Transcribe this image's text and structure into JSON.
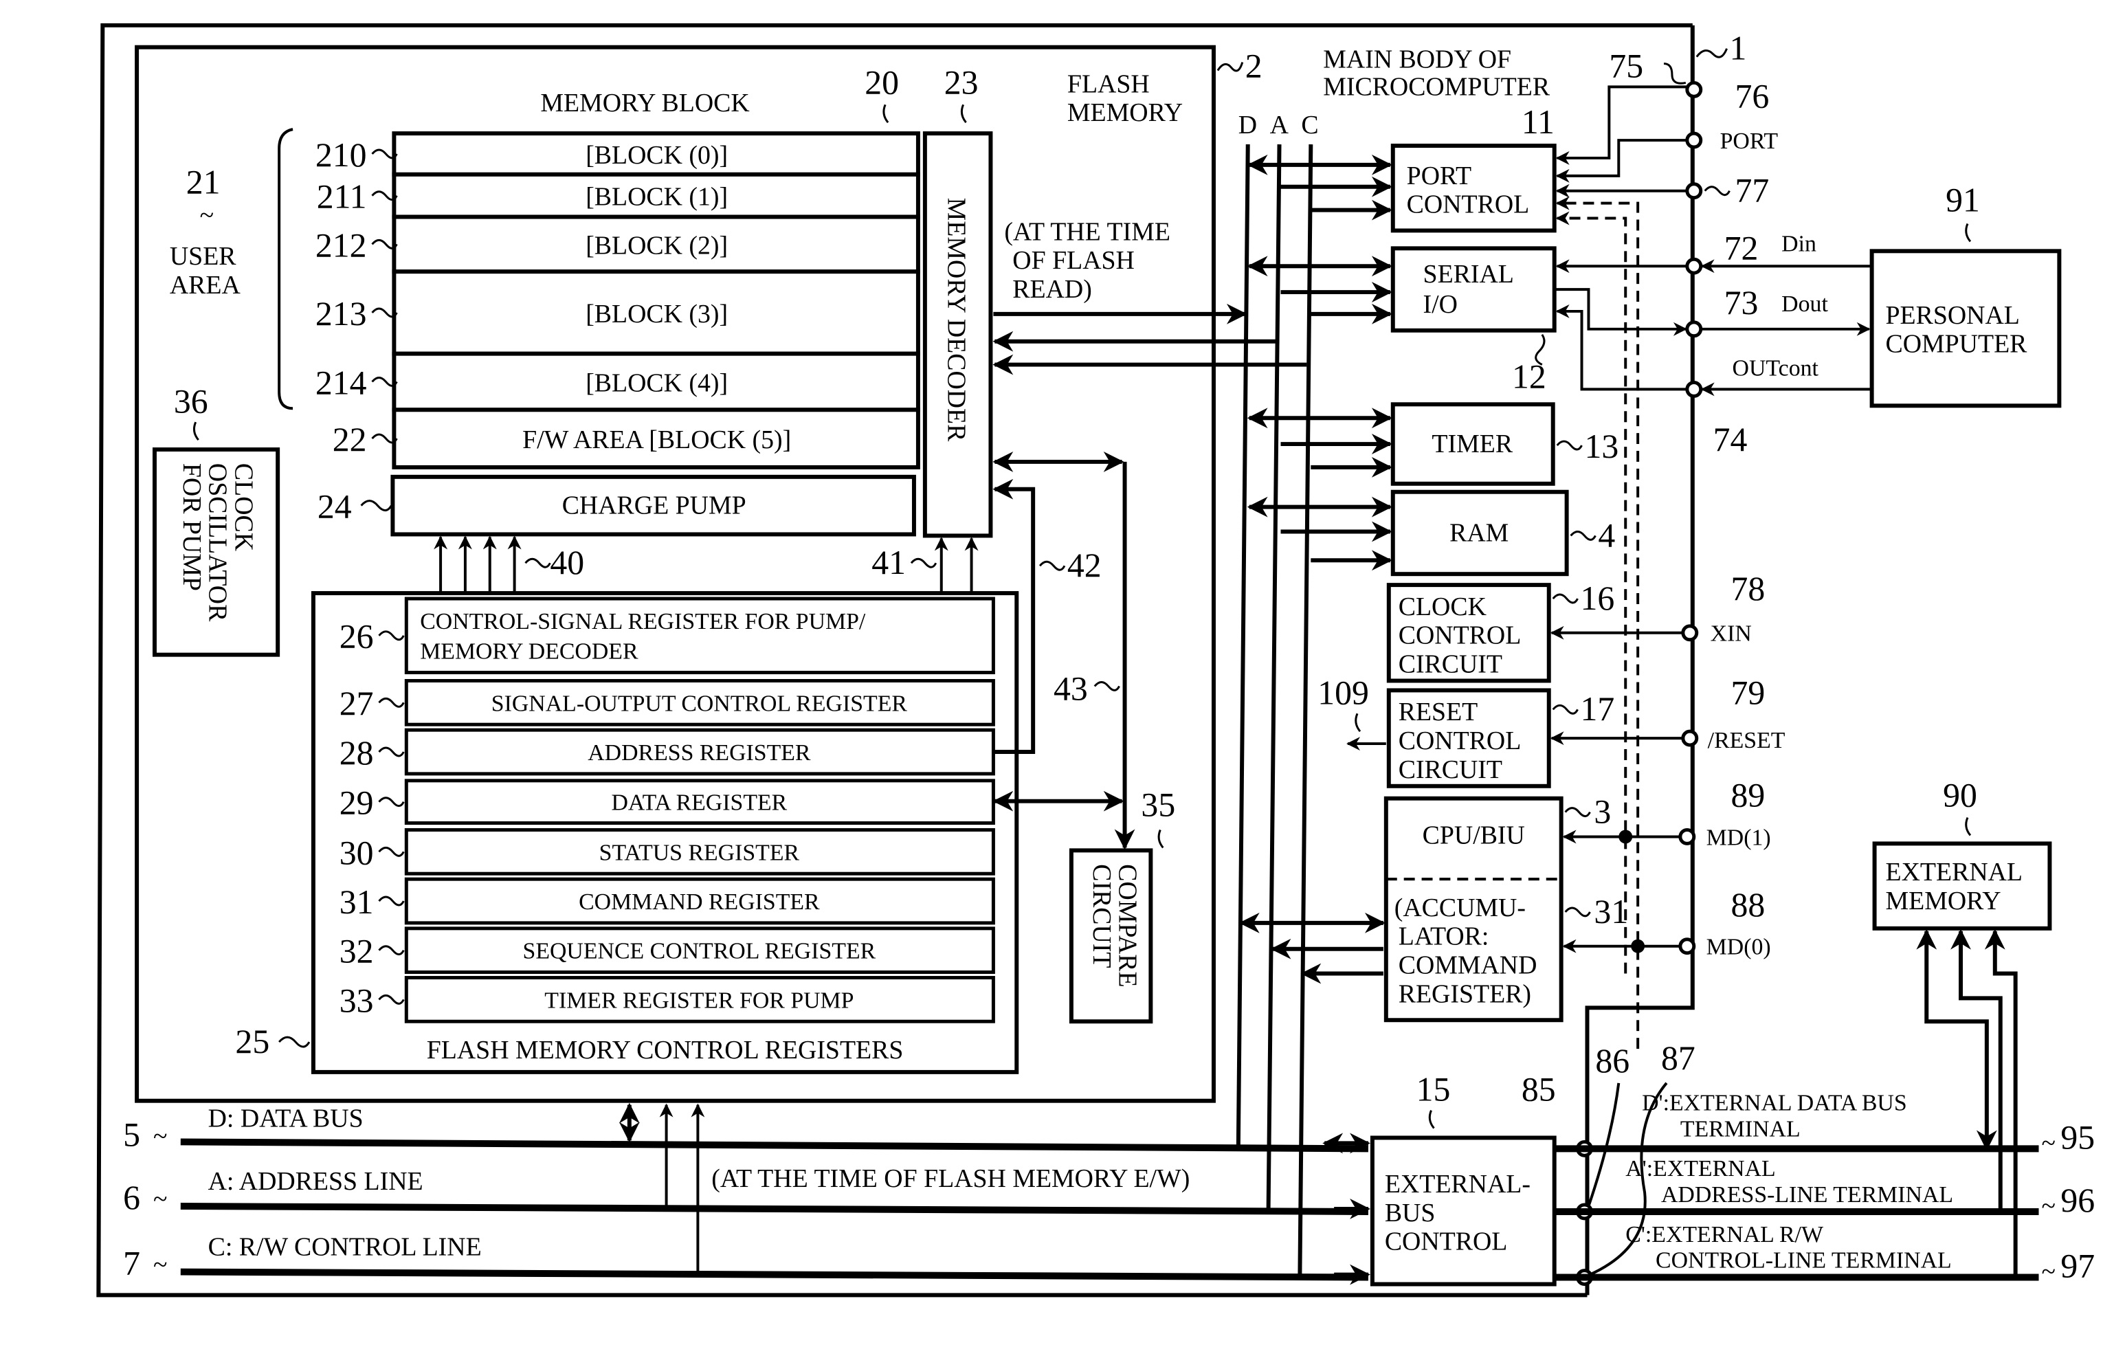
{
  "main_body": {
    "label_line1": "MAIN BODY OF",
    "label_line2": "MICROCOMPUTER",
    "ref": "1"
  },
  "flash_memory": {
    "label_line1": "FLASH",
    "label_line2": "MEMORY",
    "ref": "2"
  },
  "memory_block": {
    "title": "MEMORY BLOCK",
    "ref": "20",
    "user_area": {
      "ref": "21",
      "label_line1": "USER",
      "label_line2": "AREA"
    },
    "blocks": [
      {
        "ref": "210",
        "label": "[BLOCK (0)]"
      },
      {
        "ref": "211",
        "label": "[BLOCK (1)]"
      },
      {
        "ref": "212",
        "label": "[BLOCK (2)]"
      },
      {
        "ref": "213",
        "label": "[BLOCK (3)]"
      },
      {
        "ref": "214",
        "label": "[BLOCK (4)]"
      },
      {
        "ref": "22",
        "label": "F/W AREA [BLOCK (5)]"
      }
    ]
  },
  "memory_decoder": {
    "ref": "23",
    "label": "MEMORY DECODER"
  },
  "charge_pump": {
    "ref": "24",
    "label": "CHARGE PUMP"
  },
  "clock_oscillator": {
    "ref": "36",
    "label_lines": [
      "CLOCK",
      "OSCILLATOR",
      "FOR PUMP"
    ]
  },
  "signal_refs": {
    "pump_signals": "40",
    "decoder_signals": "41",
    "address_path": "42",
    "data_path": "43",
    "reset_output": "109"
  },
  "flash_read_note": [
    "(AT THE TIME",
    "OF FLASH",
    "READ)"
  ],
  "flash_ew_note": "(AT THE TIME OF FLASH MEMORY E/W)",
  "control_registers": {
    "ref": "25",
    "title": "FLASH MEMORY CONTROL REGISTERS",
    "items": [
      {
        "ref": "26",
        "label_line1": "CONTROL-SIGNAL REGISTER FOR PUMP/",
        "label_line2": "MEMORY DECODER"
      },
      {
        "ref": "27",
        "label_line1": "SIGNAL-OUTPUT CONTROL REGISTER"
      },
      {
        "ref": "28",
        "label_line1": "ADDRESS REGISTER"
      },
      {
        "ref": "29",
        "label_line1": "DATA REGISTER"
      },
      {
        "ref": "30",
        "label_line1": "STATUS REGISTER"
      },
      {
        "ref": "31",
        "label_line1": "COMMAND REGISTER"
      },
      {
        "ref": "32",
        "label_line1": "SEQUENCE CONTROL REGISTER"
      },
      {
        "ref": "33",
        "label_line1": "TIMER REGISTER FOR PUMP"
      }
    ]
  },
  "compare_circuit": {
    "ref": "35",
    "label_line1": "COMPARE",
    "label_line2": "CIRCUIT"
  },
  "bus_letters": {
    "d": "D",
    "a": "A",
    "c": "C"
  },
  "peripherals": {
    "port_control": {
      "ref": "11",
      "label_line1": "PORT",
      "label_line2": "CONTROL"
    },
    "serial_io": {
      "ref": "12",
      "label_line1": "SERIAL",
      "label_line2": "I/O"
    },
    "timer": {
      "ref": "13",
      "label": "TIMER"
    },
    "ram": {
      "ref": "4",
      "label": "RAM"
    },
    "clock_control": {
      "ref": "16",
      "label_lines": [
        "CLOCK",
        "CONTROL",
        "CIRCUIT"
      ]
    },
    "reset_control": {
      "ref": "17",
      "label_lines": [
        "RESET",
        "CONTROL",
        "CIRCUIT"
      ]
    },
    "cpu": {
      "ref": "3",
      "label": "CPU/BIU",
      "sub_ref": "31",
      "sub_lines": [
        "(ACCUMU-",
        "LATOR:",
        "COMMAND",
        "REGISTER)"
      ]
    },
    "external_bus_control": {
      "ref": "15",
      "label_lines": [
        "EXTERNAL-",
        "BUS",
        "CONTROL"
      ]
    }
  },
  "terminals": {
    "t75": "75",
    "t76": "76",
    "port": "PORT",
    "t77": "77",
    "t72": "72",
    "din": "Din",
    "t73": "73",
    "dout": "Dout",
    "t74": "74",
    "outcont": "OUTcont",
    "t78": "78",
    "xin": "XIN",
    "t79": "79",
    "reset": "/RESET",
    "t89": "89",
    "md1": "MD(1)",
    "t88": "88",
    "md0": "MD(0)",
    "t85": "85",
    "t86": "86",
    "t87": "87"
  },
  "personal_computer": {
    "ref": "91",
    "label_line1": "PERSONAL",
    "label_line2": "COMPUTER"
  },
  "external_memory": {
    "ref": "90",
    "label_line1": "EXTERNAL",
    "label_line2": "MEMORY"
  },
  "external_terminals": {
    "d": {
      "ref": "95",
      "label_line1": "D':EXTERNAL DATA BUS",
      "label_line2": "TERMINAL"
    },
    "a": {
      "ref": "96",
      "label_line1": "A':EXTERNAL",
      "label_line2": "ADDRESS-LINE TERMINAL"
    },
    "c": {
      "ref": "97",
      "label_line1": "C':EXTERNAL R/W",
      "label_line2": "CONTROL-LINE TERMINAL"
    }
  },
  "buses": [
    {
      "ref": "5",
      "label": "D: DATA BUS"
    },
    {
      "ref": "6",
      "label": "A: ADDRESS LINE"
    },
    {
      "ref": "7",
      "label": "C: R/W CONTROL LINE"
    }
  ]
}
